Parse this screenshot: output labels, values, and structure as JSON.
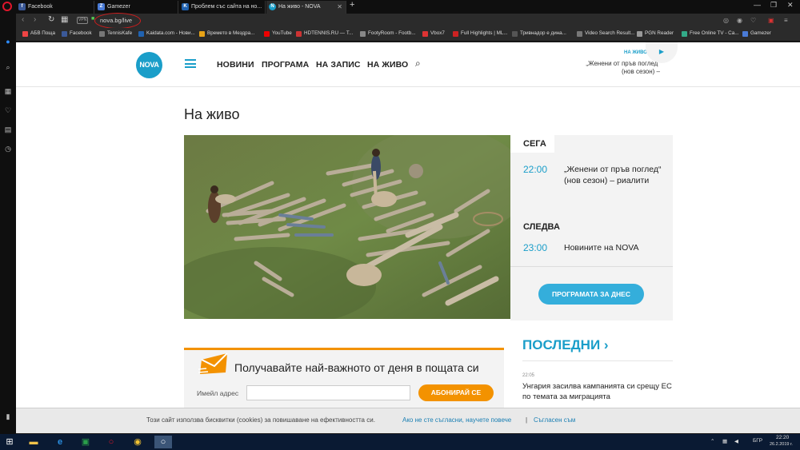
{
  "browser": {
    "tabs": [
      {
        "title": "Facebook",
        "favicon": "f",
        "color": "#3b5998"
      },
      {
        "title": "Gamezer",
        "favicon": "Z",
        "color": "#4a7bd6"
      },
      {
        "title": "Проблем със сайта на но...",
        "favicon": "K",
        "color": "#2062b0"
      },
      {
        "title": "На живо - NOVA",
        "favicon": "N",
        "color": "#1a9ec9"
      }
    ],
    "new_tab": "+",
    "address": "nova.bg/live",
    "vpn": "VPN",
    "bookmarks": [
      {
        "label": "АБВ Поща",
        "color": "#e44"
      },
      {
        "label": "Facebook",
        "color": "#3b5998"
      },
      {
        "label": "TennisKafe",
        "color": "#777"
      },
      {
        "label": "Kaidata.com - Нови...",
        "color": "#2062b0"
      },
      {
        "label": "Времето в Мездра...",
        "color": "#e8a317"
      },
      {
        "label": "YouTube",
        "color": "#e00"
      },
      {
        "label": "HDTENNIS.RU — Т...",
        "color": "#c33"
      },
      {
        "label": "FootyRoom - Footb...",
        "color": "#888"
      },
      {
        "label": "Vbox7",
        "color": "#d33"
      },
      {
        "label": "Full Highlights | ML...",
        "color": "#c22"
      },
      {
        "label": "Тривнадор е дина...",
        "color": "#555"
      },
      {
        "label": "Video Search Result...",
        "color": "#777"
      },
      {
        "label": "PGN Reader",
        "color": "#999"
      },
      {
        "label": "Free Online TV - Ca...",
        "color": "#3a8"
      },
      {
        "label": "Gamezer",
        "color": "#4a7bd6"
      }
    ]
  },
  "site": {
    "logo": "NOVA",
    "nav": [
      "НОВИНИ",
      "ПРОГРАМА",
      "НА ЗАПИС",
      "НА ЖИВО"
    ],
    "live_label": "НА ЖИВО",
    "live_show": "„Женени от пръв поглед“ (нов сезон) –"
  },
  "main": {
    "title": "На живо"
  },
  "schedule": {
    "now_label": "СЕГА",
    "now_time": "22:00",
    "now_show": "„Женени от пръв поглед“ (нов сезон) – риалити",
    "next_label": "СЛЕДВА",
    "next_time": "23:00",
    "next_show": "Новините на NOVA",
    "today_button": "ПРОГРАМАТА ЗА ДНЕС"
  },
  "newsletter": {
    "title": "Получавайте най-важното от деня в пощата си",
    "email_label": "Имейл адрес",
    "email_value": "",
    "subscribe": "АБОНИРАЙ СЕ"
  },
  "latest": {
    "heading": "ПОСЛЕДНИ ›",
    "items": [
      {
        "time": "22:05",
        "title": "Унгария засилва кампанията си срещу ЕС по темата за миграцията"
      }
    ]
  },
  "cookie": {
    "text": "Този сайт използва бисквитки (cookies) за повишаване на ефективността си.",
    "disagree": "Ако не сте съгласни, научете повече",
    "sep": "|",
    "agree": "Съгласен съм"
  },
  "taskbar": {
    "time": "22:20",
    "date": "26.2.2019 г.",
    "lang": "БГР"
  }
}
